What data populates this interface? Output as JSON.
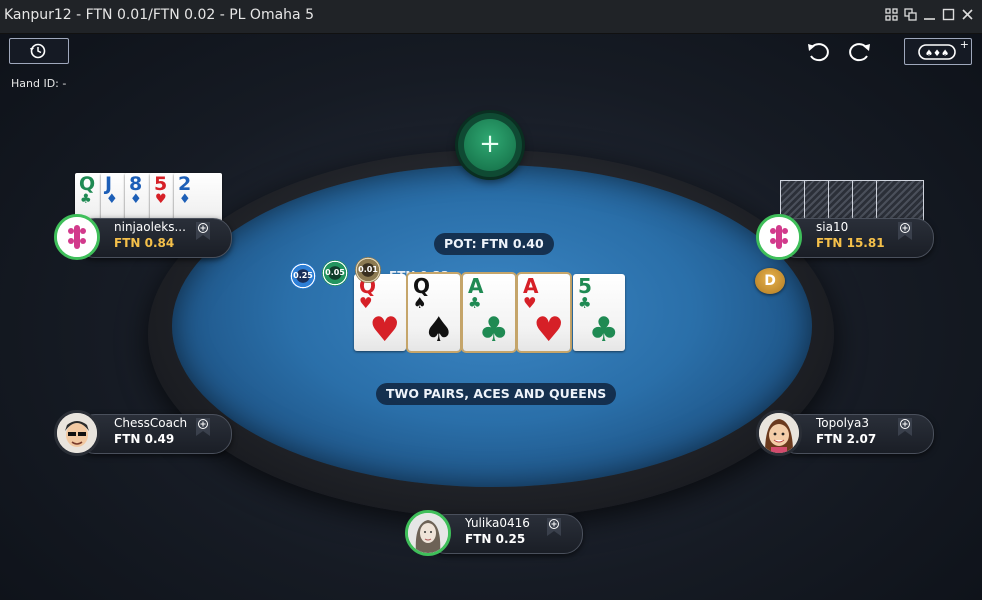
{
  "window": {
    "title": "Kanpur12 - FTN 0.01/FTN 0.02 - PL Omaha 5",
    "controls": [
      "tile-icon",
      "restore-icon",
      "minimize-icon",
      "maximize-icon",
      "close-icon"
    ]
  },
  "toolbar": {
    "hand_id": "Hand ID: -",
    "history_icon": "history-icon",
    "undo_icon": "undo-icon",
    "redo_icon": "redo-icon",
    "tables_icon": "cards-table-icon",
    "tables_plus": "+"
  },
  "table": {
    "pot": "POT: FTN 0.40",
    "hand_description": "TWO PAIRS, ACES AND QUEENS",
    "add_button_glyph": "+",
    "bet_amount": "FTN 0.32",
    "chips": [
      "0.25",
      "0.05",
      "0.01"
    ],
    "dealer_label": "D",
    "board": [
      {
        "rank": "Q",
        "suit": "♥",
        "color": "red"
      },
      {
        "rank": "Q",
        "suit": "♠",
        "color": "black"
      },
      {
        "rank": "A",
        "suit": "♣",
        "color": "green"
      },
      {
        "rank": "A",
        "suit": "♥",
        "color": "red"
      },
      {
        "rank": "5",
        "suit": "♣",
        "color": "green"
      }
    ]
  },
  "seats": {
    "top_left": {
      "name": "ninjaoleks...",
      "stack": "FTN 0.84",
      "cards": [
        {
          "rank": "Q",
          "suit": "♣",
          "color": "green"
        },
        {
          "rank": "J",
          "suit": "♦",
          "color": "blue"
        },
        {
          "rank": "8",
          "suit": "♦",
          "color": "blue"
        },
        {
          "rank": "5",
          "suit": "♥",
          "color": "red"
        },
        {
          "rank": "2",
          "suit": "♦",
          "color": "blue"
        }
      ]
    },
    "top_right": {
      "name": "sia10",
      "stack": "FTN 15.81"
    },
    "mid_left": {
      "name": "ChessCoach",
      "stack": "FTN 0.49"
    },
    "mid_right": {
      "name": "Topolya3",
      "stack": "FTN 2.07"
    },
    "bottom": {
      "name": "Yulika0416",
      "stack": "FTN 0.25"
    }
  },
  "colors": {
    "felt": "#2a6fa9",
    "active_ring": "#3fbf5a",
    "highlight_stack": "#f5c04a",
    "winning_border": "#c5a56a"
  }
}
